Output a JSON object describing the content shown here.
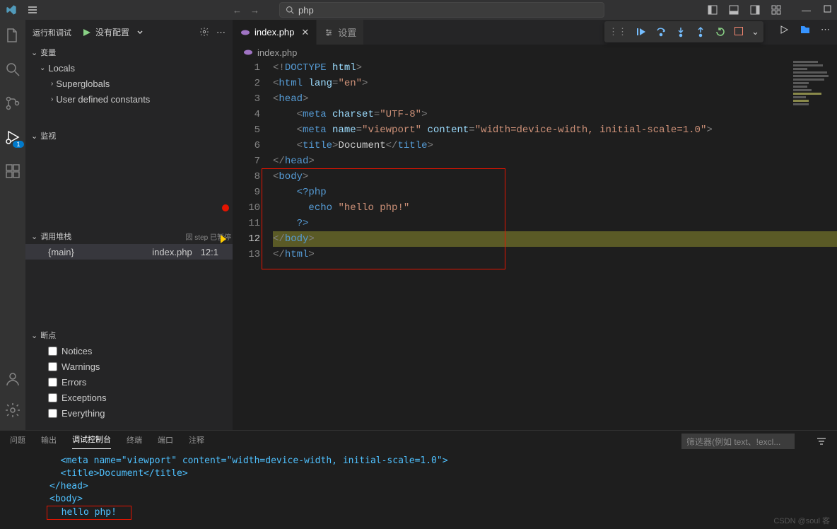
{
  "titlebar": {
    "search_text": "php"
  },
  "debug": {
    "toolbar_label": "运行和调试",
    "config_name": "没有配置"
  },
  "sidebar": {
    "variables": "变量",
    "locals": "Locals",
    "superglobals": "Superglobals",
    "user_constants": "User defined constants",
    "watch": "监视",
    "callstack": "调用堆栈",
    "callstack_status": "因 step 已暂停",
    "callstack_items": [
      {
        "name": "{main}",
        "file": "index.php",
        "pos": "12:1"
      }
    ],
    "breakpoints": "断点",
    "bp_items": [
      "Notices",
      "Warnings",
      "Errors",
      "Exceptions",
      "Everything"
    ]
  },
  "editor": {
    "filename": "index.php",
    "settings_tab": "设置",
    "breadcrumb": "index.php",
    "lines": [
      "<!DOCTYPE html>",
      "<html lang=\"en\">",
      "<head>",
      "    <meta charset=\"UTF-8\">",
      "    <meta name=\"viewport\" content=\"width=device-width, initial-scale=1.0\">",
      "    <title>Document</title>",
      "</head>",
      "<body>",
      "    <?php",
      "      echo \"hello php!\"",
      "    ?>",
      "</body>",
      "</html>"
    ],
    "current_line": 12,
    "breakpoint_line": 10
  },
  "panel": {
    "tabs": [
      "问题",
      "输出",
      "调试控制台",
      "终端",
      "端口",
      "注释"
    ],
    "active_tab": "调试控制台",
    "filter_placeholder": "筛选器(例如 text、!excl...",
    "output": {
      "meta_line": "<meta name=\"viewport\" content=\"width=device-width, initial-scale=1.0\">",
      "title_line": "<title>Document</title>",
      "head_close": "</head>",
      "body_open": "<body>",
      "hello": "hello php!"
    }
  },
  "watermark": "CSDN @soul 客"
}
